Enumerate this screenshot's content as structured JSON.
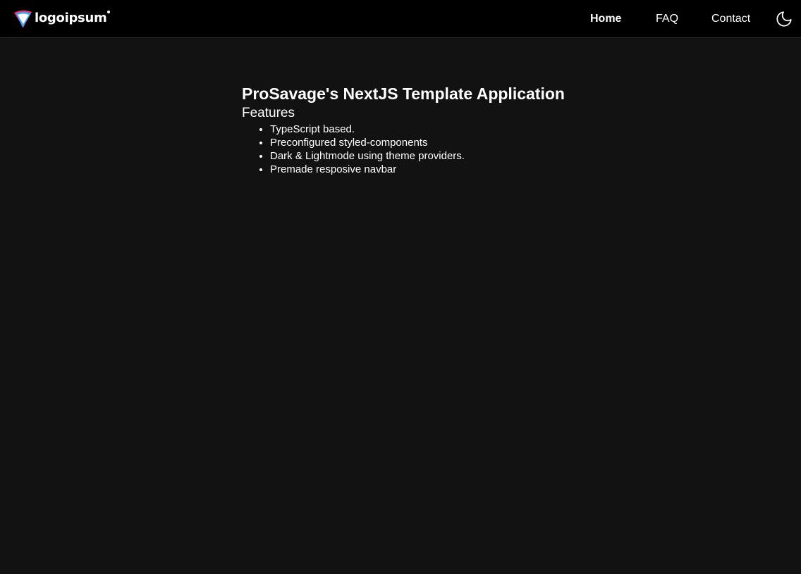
{
  "navbar": {
    "logo_text": "logoipsum",
    "links": [
      {
        "label": "Home",
        "active": true
      },
      {
        "label": "FAQ",
        "active": false
      },
      {
        "label": "Contact",
        "active": false
      }
    ],
    "theme_toggle_icon": "moon-icon"
  },
  "main": {
    "title": "ProSavage's NextJS Template Application",
    "section_title": "Features",
    "features": [
      "TypeScript based.",
      "Preconfigured styled-components",
      "Dark & Lightmode using theme providers.",
      "Premade resposive navbar"
    ]
  },
  "colors": {
    "page_background": "#121212",
    "navbar_background": "#000000",
    "text": "#ffffff",
    "logo_pink": "#e8336d",
    "logo_blue": "#3fa9f5"
  }
}
